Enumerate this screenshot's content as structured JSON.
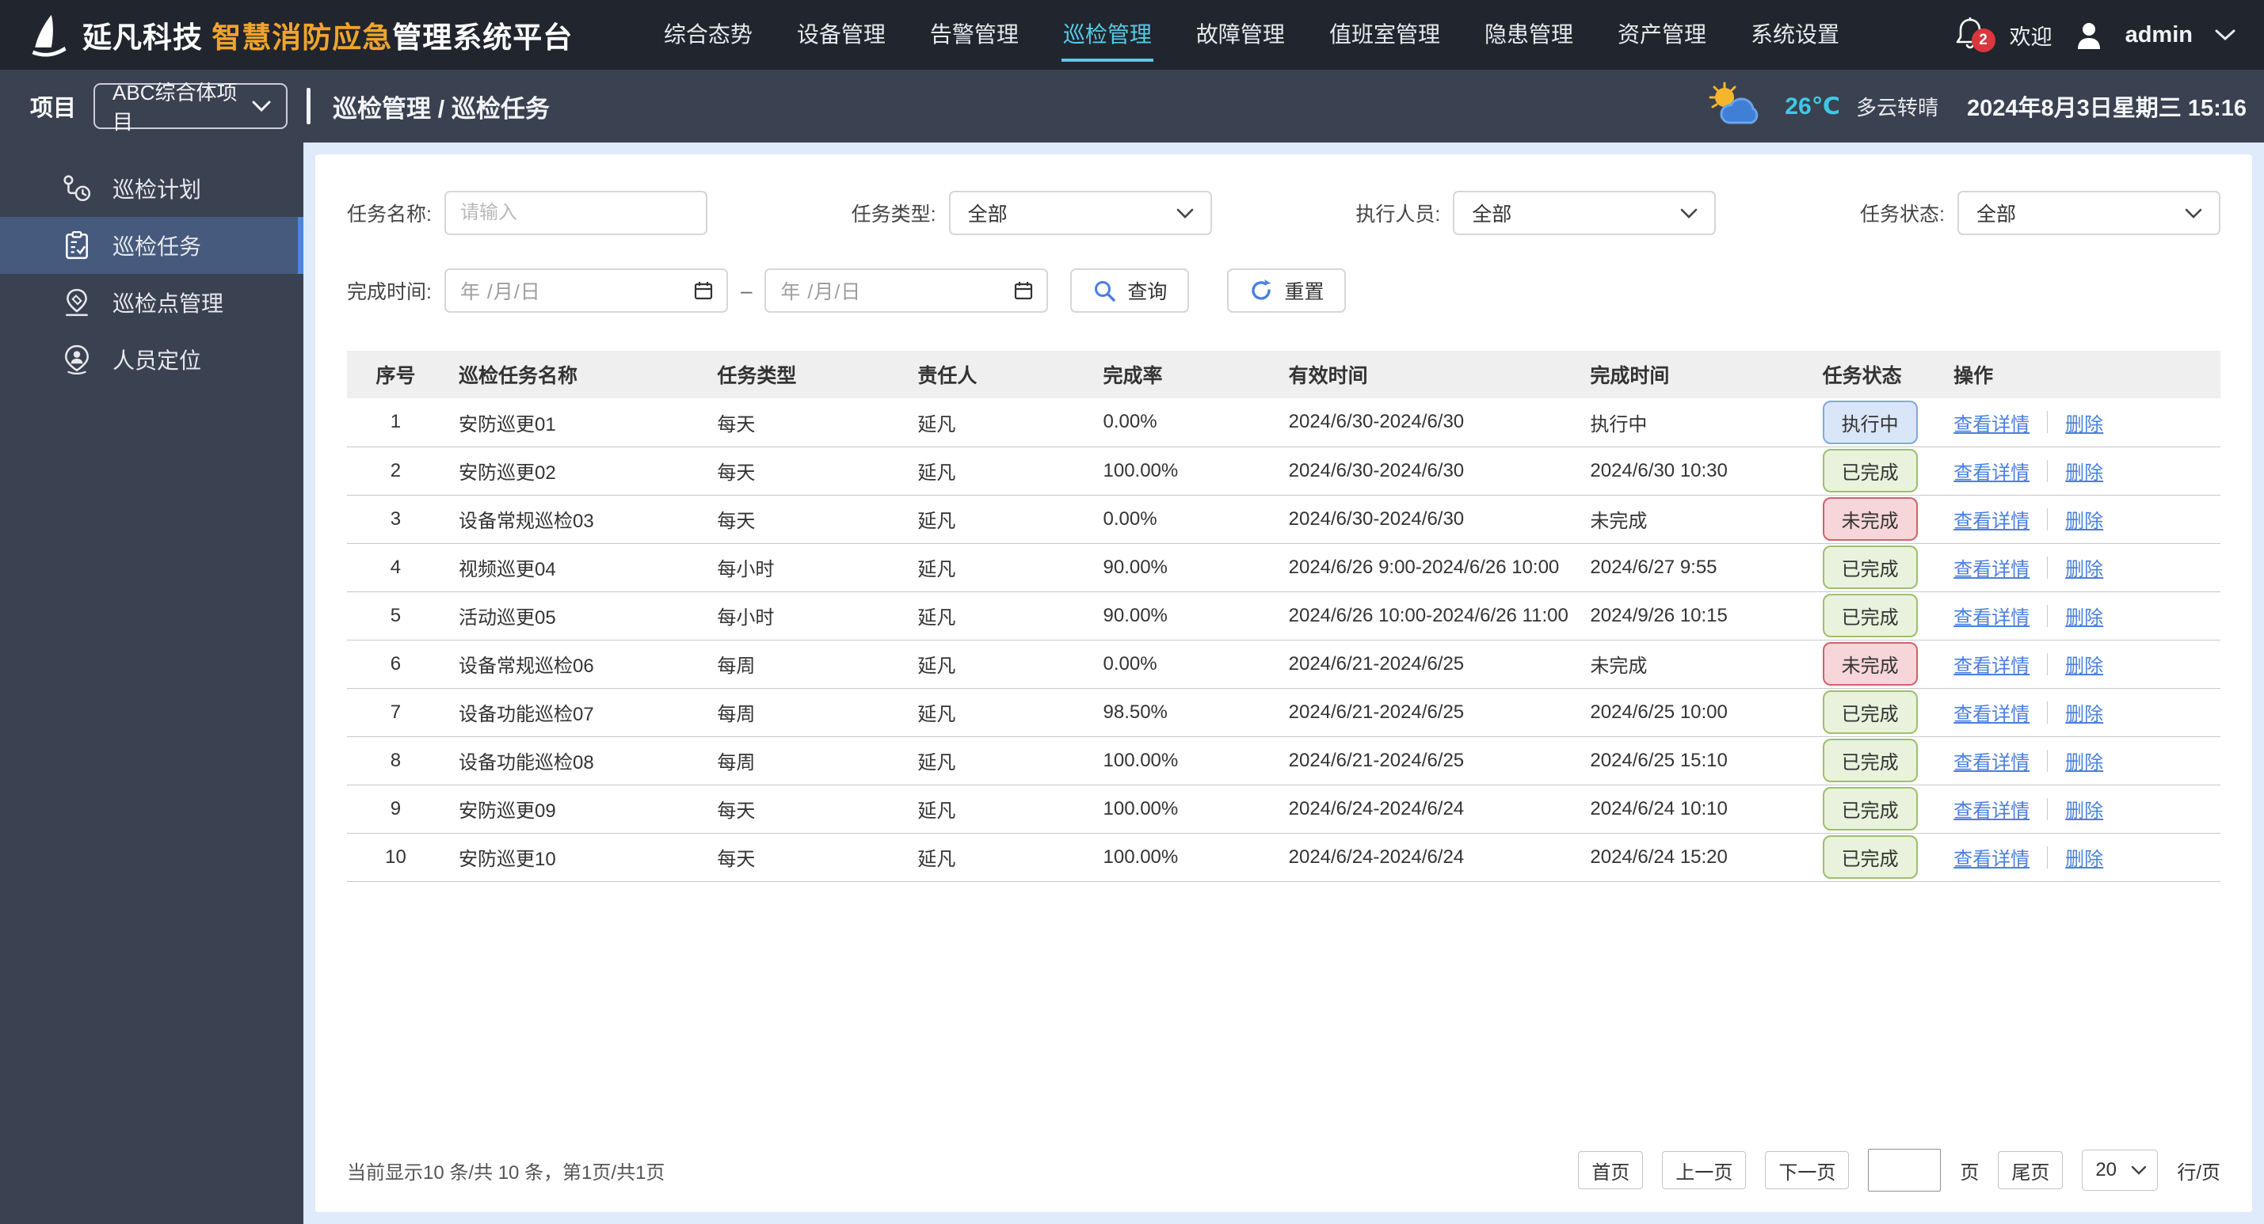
{
  "brand": {
    "company": "延凡科技",
    "product_highlight": "智慧消防应急",
    "product_rest": "管理系统平台"
  },
  "topnav": {
    "items": [
      "综合态势",
      "设备管理",
      "告警管理",
      "巡检管理",
      "故障管理",
      "值班室管理",
      "隐患管理",
      "资产管理",
      "系统设置"
    ],
    "active": "巡检管理"
  },
  "user": {
    "notification_count": "2",
    "welcome": "欢迎",
    "name": "admin"
  },
  "project": {
    "label": "项目",
    "selected": "ABC综合体项目"
  },
  "breadcrumb": "巡检管理 / 巡检任务",
  "weather": {
    "temp": "26℃",
    "desc": "多云转晴",
    "datetime": "2024年8月3日星期三 15:16"
  },
  "sidebar": {
    "items": [
      "巡检计划",
      "巡检任务",
      "巡检点管理",
      "人员定位"
    ],
    "active": "巡检任务"
  },
  "filters": {
    "task_name": {
      "label": "任务名称:",
      "placeholder": "请输入",
      "value": ""
    },
    "task_type": {
      "label": "任务类型:",
      "value": "全部"
    },
    "executor": {
      "label": "执行人员:",
      "value": "全部"
    },
    "task_status": {
      "label": "任务状态:",
      "value": "全部"
    },
    "finish_time": {
      "label": "完成时间:",
      "placeholder": "年 /月/日",
      "separator": "–"
    },
    "query_label": "查询",
    "reset_label": "重置"
  },
  "table": {
    "columns": [
      "序号",
      "巡检任务名称",
      "任务类型",
      "责任人",
      "完成率",
      "有效时间",
      "完成时间",
      "任务状态",
      "操作"
    ],
    "action_labels": {
      "detail": "查看详情",
      "delete": "删除"
    },
    "rows": [
      {
        "no": "1",
        "name": "安防巡更01",
        "type": "每天",
        "owner": "延凡",
        "rate": "0.00%",
        "valid": "2024/6/30-2024/6/30",
        "finish": "执行中",
        "status": "执行中",
        "status_kind": "running"
      },
      {
        "no": "2",
        "name": "安防巡更02",
        "type": "每天",
        "owner": "延凡",
        "rate": "100.00%",
        "valid": "2024/6/30-2024/6/30",
        "finish": "2024/6/30 10:30",
        "status": "已完成",
        "status_kind": "done"
      },
      {
        "no": "3",
        "name": "设备常规巡检03",
        "type": "每天",
        "owner": "延凡",
        "rate": "0.00%",
        "valid": "2024/6/30-2024/6/30",
        "finish": "未完成",
        "status": "未完成",
        "status_kind": "undone"
      },
      {
        "no": "4",
        "name": "视频巡更04",
        "type": "每小时",
        "owner": "延凡",
        "rate": "90.00%",
        "valid": "2024/6/26 9:00-2024/6/26 10:00",
        "finish": "2024/6/27 9:55",
        "status": "已完成",
        "status_kind": "done"
      },
      {
        "no": "5",
        "name": "活动巡更05",
        "type": "每小时",
        "owner": "延凡",
        "rate": "90.00%",
        "valid": "2024/6/26 10:00-2024/6/26 11:00",
        "finish": "2024/9/26 10:15",
        "status": "已完成",
        "status_kind": "done"
      },
      {
        "no": "6",
        "name": "设备常规巡检06",
        "type": "每周",
        "owner": "延凡",
        "rate": "0.00%",
        "valid": "2024/6/21-2024/6/25",
        "finish": "未完成",
        "status": "未完成",
        "status_kind": "undone"
      },
      {
        "no": "7",
        "name": "设备功能巡检07",
        "type": "每周",
        "owner": "延凡",
        "rate": "98.50%",
        "valid": "2024/6/21-2024/6/25",
        "finish": "2024/6/25 10:00",
        "status": "已完成",
        "status_kind": "done"
      },
      {
        "no": "8",
        "name": "设备功能巡检08",
        "type": "每周",
        "owner": "延凡",
        "rate": "100.00%",
        "valid": "2024/6/21-2024/6/25",
        "finish": "2024/6/25 15:10",
        "status": "已完成",
        "status_kind": "done"
      },
      {
        "no": "9",
        "name": "安防巡更09",
        "type": "每天",
        "owner": "延凡",
        "rate": "100.00%",
        "valid": "2024/6/24-2024/6/24",
        "finish": "2024/6/24 10:10",
        "status": "已完成",
        "status_kind": "done"
      },
      {
        "no": "10",
        "name": "安防巡更10",
        "type": "每天",
        "owner": "延凡",
        "rate": "100.00%",
        "valid": "2024/6/24-2024/6/24",
        "finish": "2024/6/24 15:20",
        "status": "已完成",
        "status_kind": "done"
      }
    ]
  },
  "pagination": {
    "summary": "当前显示10 条/共 10 条，第1页/共1页",
    "first": "首页",
    "prev": "上一页",
    "next": "下一页",
    "page_input_value": "",
    "page_suffix": "页",
    "last": "尾页",
    "page_size": "20",
    "page_size_suffix": "行/页"
  },
  "colors": {
    "topbar_bg": "#21252d",
    "subbar_bg": "#3a4150",
    "sidebar_active_bg": "#455a7d",
    "sidebar_active_border": "#4e86d8",
    "accent_cyan": "#54cbe8",
    "brand_orange": "#f0a42c",
    "content_bg": "#dfeafa",
    "table_header_bg": "#efefef",
    "link_blue": "#4a7fe0",
    "badge_running_bg": "#d9e6f8",
    "badge_running_border": "#84a7de",
    "badge_done_bg": "#e9f2dc",
    "badge_done_border": "#9cbf6e",
    "badge_undone_bg": "#f6d6d9",
    "badge_undone_border": "#ce636c",
    "temp_cyan": "#3fc8e4",
    "notification_red": "#d9363e"
  }
}
